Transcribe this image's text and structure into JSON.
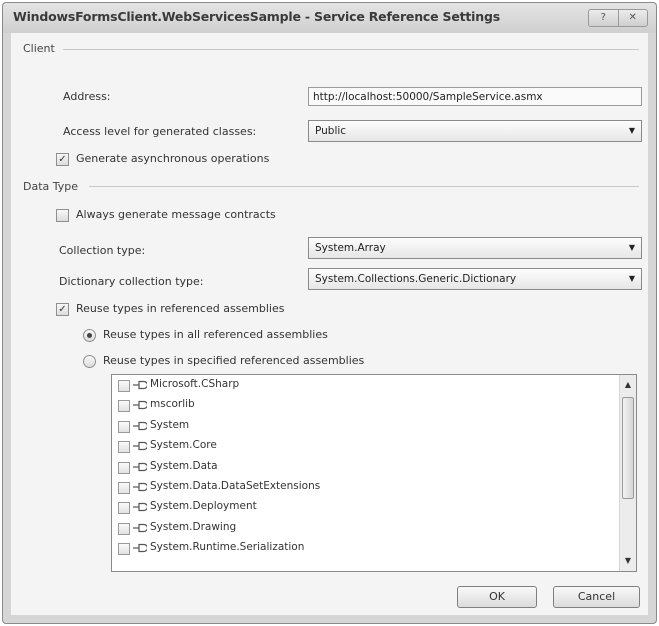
{
  "window": {
    "title": "WindowsFormsClient.WebServicesSample - Service Reference Settings",
    "help_glyph": "?",
    "close_glyph": "✕"
  },
  "client_group": {
    "label": "Client",
    "address_label": "Address:",
    "address_value": "http://localhost:50000/SampleService.asmx",
    "access_label": "Access level for generated classes:",
    "access_value": "Public",
    "async_label": "Generate asynchronous operations",
    "async_checked": true
  },
  "data_type_group": {
    "label": "Data Type",
    "message_contracts_label": "Always generate message contracts",
    "message_contracts_checked": false,
    "collection_label": "Collection type:",
    "collection_value": "System.Array",
    "dictionary_label": "Dictionary collection type:",
    "dictionary_value": "System.Collections.Generic.Dictionary",
    "reuse_label": "Reuse types in referenced assemblies",
    "reuse_checked": true,
    "reuse_all_label": "Reuse types in all referenced assemblies",
    "reuse_all_selected": true,
    "reuse_specified_label": "Reuse types in specified referenced assemblies",
    "reuse_specified_selected": false
  },
  "assemblies": [
    {
      "name": "Microsoft.CSharp",
      "checked": false
    },
    {
      "name": "mscorlib",
      "checked": false
    },
    {
      "name": "System",
      "checked": false
    },
    {
      "name": "System.Core",
      "checked": false
    },
    {
      "name": "System.Data",
      "checked": false
    },
    {
      "name": "System.Data.DataSetExtensions",
      "checked": false
    },
    {
      "name": "System.Deployment",
      "checked": false
    },
    {
      "name": "System.Drawing",
      "checked": false
    },
    {
      "name": "System.Runtime.Serialization",
      "checked": false
    }
  ],
  "buttons": {
    "ok": "OK",
    "cancel": "Cancel"
  },
  "glyphs": {
    "check": "✓",
    "dropdown": "▼",
    "scroll_up": "▲",
    "scroll_down": "▼"
  }
}
